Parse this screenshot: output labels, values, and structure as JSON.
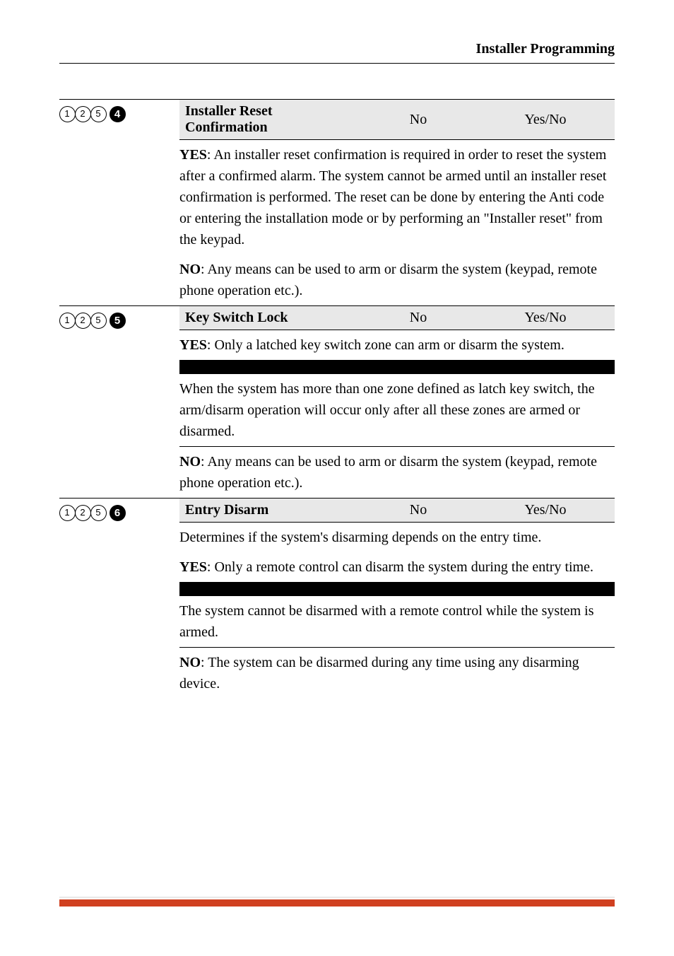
{
  "header": {
    "title": "Installer Programming"
  },
  "sections": [
    {
      "code_digits": [
        "1",
        "2",
        "5"
      ],
      "code_bold": "4",
      "title": "Installer Reset Confirmation",
      "default": "No",
      "range": "Yes/No",
      "para1_pre": "YES",
      "para1": ": An installer reset confirmation is required in order to reset the system after a confirmed alarm. The system cannot be armed until an installer reset confirmation is performed. The reset can be done by entering the Anti code or entering the installation mode or by performing an \"Installer reset\" from the keypad.",
      "para2_pre": "NO",
      "para2": ": Any means can be used to arm or disarm the system (keypad, remote phone operation etc.)."
    },
    {
      "code_digits": [
        "1",
        "2",
        "5"
      ],
      "code_bold": "5",
      "title": "Key Switch Lock",
      "default": "No",
      "range": "Yes/No",
      "para1_pre": "YES",
      "para1": ": Only a latched key switch zone can arm or disarm the system.",
      "boxed": "When the system has more than one zone defined as latch key switch, the arm/disarm operation will occur only after all these zones are armed or disarmed.",
      "para2_pre": "NO",
      "para2": ": Any means can be used to arm or disarm the system (keypad, remote phone operation etc.)."
    },
    {
      "code_digits": [
        "1",
        "2",
        "5"
      ],
      "code_bold": "6",
      "title": "Entry Disarm",
      "default": "No",
      "range": "Yes/No",
      "para1": "Determines if the system's disarming depends on the entry time.",
      "para2_pre": "YES",
      "para2": ": Only a remote control can disarm the system during the entry time.",
      "boxed": "The system cannot be disarmed with a remote control while the system is armed.",
      "para3_pre": "NO",
      "para3": ": The system can be disarmed during any time using any disarming device."
    }
  ]
}
